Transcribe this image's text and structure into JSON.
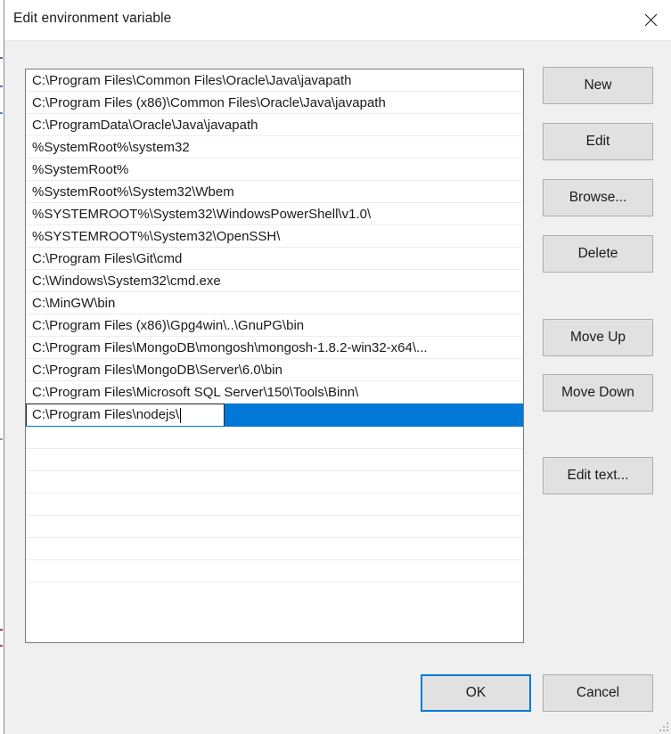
{
  "window": {
    "title": "Edit environment variable",
    "close_icon": "close-icon"
  },
  "colors": {
    "accent": "#0078d7",
    "body_background": "#f0f0f0",
    "titlebar_background": "#ffffff",
    "button_face": "#e1e1e1",
    "button_border": "#adadad",
    "list_background": "#ffffff",
    "text": "#1a1a1a"
  },
  "path_list": {
    "entries": [
      "C:\\Program Files\\Common Files\\Oracle\\Java\\javapath",
      "C:\\Program Files (x86)\\Common Files\\Oracle\\Java\\javapath",
      "C:\\ProgramData\\Oracle\\Java\\javapath",
      "%SystemRoot%\\system32",
      "%SystemRoot%",
      "%SystemRoot%\\System32\\Wbem",
      "%SYSTEMROOT%\\System32\\WindowsPowerShell\\v1.0\\",
      "%SYSTEMROOT%\\System32\\OpenSSH\\",
      "C:\\Program Files\\Git\\cmd",
      "C:\\Windows\\System32\\cmd.exe",
      "C:\\MinGW\\bin",
      "C:\\Program Files (x86)\\Gpg4win\\..\\GnuPG\\bin",
      "C:\\Program Files\\MongoDB\\mongosh\\mongosh-1.8.2-win32-x64\\...",
      "C:\\Program Files\\MongoDB\\Server\\6.0\\bin",
      "C:\\Program Files\\Microsoft SQL Server\\150\\Tools\\Binn\\"
    ],
    "editing_row": {
      "value": "C:\\Program Files\\nodejs\\",
      "selected": true
    },
    "empty_row_count": 7
  },
  "side_buttons": {
    "new": "New",
    "edit": "Edit",
    "browse": "Browse...",
    "delete": "Delete",
    "move_up": "Move Up",
    "move_down": "Move Down",
    "edit_text": "Edit text..."
  },
  "bottom_buttons": {
    "ok": "OK",
    "cancel": "Cancel"
  }
}
